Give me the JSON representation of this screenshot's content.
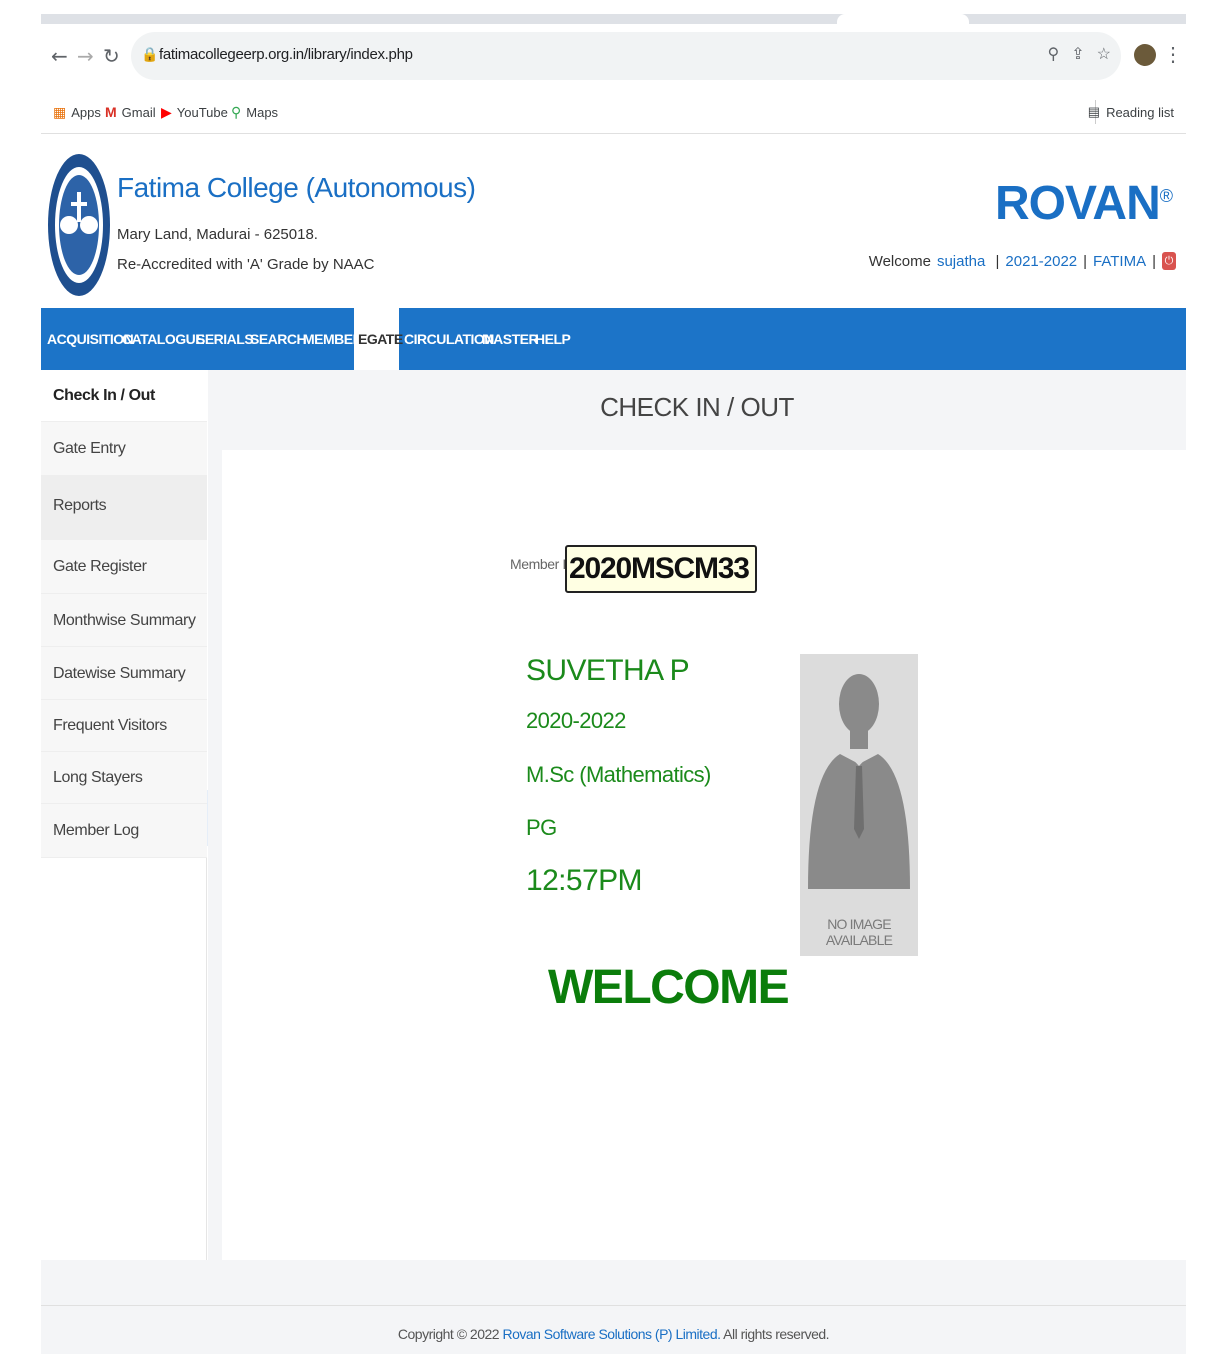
{
  "browser": {
    "url": "fatimacollegeerp.org.in/library/index.php",
    "bookmarks": [
      {
        "label": "Apps",
        "icon": "apps-grid-icon"
      },
      {
        "label": "Gmail",
        "icon": "gmail-icon"
      },
      {
        "label": "YouTube",
        "icon": "youtube-icon"
      },
      {
        "label": "Maps",
        "icon": "maps-pin-icon"
      }
    ],
    "reading_list": "Reading list"
  },
  "header": {
    "college_name": "Fatima College (Autonomous)",
    "address": "Mary Land, Madurai - 625018.",
    "accreditation": "Re-Accredited with 'A' Grade by NAAC",
    "brand": "ROVAN",
    "brand_mark": "®",
    "welcome_text": "Welcome",
    "user": "sujatha",
    "year": "2021-2022",
    "institution": "FATIMA"
  },
  "menu": [
    "ACQUISITION",
    "CATALOGUE",
    "SERIALS",
    "SEARCH",
    "MEMBER",
    "EGATE",
    "CIRCULATION",
    "MASTER",
    "HELP"
  ],
  "active_menu": "EGATE",
  "sidebar": {
    "items": [
      {
        "label": "Check In / Out"
      },
      {
        "label": "Gate Entry"
      },
      {
        "label": "Reports"
      },
      {
        "label": "Gate Register"
      },
      {
        "label": "Monthwise Summary"
      },
      {
        "label": "Datewise Summary"
      },
      {
        "label": "Frequent Visitors"
      },
      {
        "label": "Long Stayers"
      },
      {
        "label": "Member Log"
      }
    ]
  },
  "main": {
    "title": "CHECK IN / OUT",
    "member_id_label": "Member ID",
    "member_id_value": "2020MSCM33",
    "member": {
      "name": "SUVETHA P",
      "batch": "2020-2022",
      "course": "M.Sc (Mathematics)",
      "level": "PG",
      "time": "12:57PM"
    },
    "photo_placeholder": "NO IMAGE AVAILABLE",
    "welcome": "WELCOME"
  },
  "footer": {
    "copyright_prefix": "Copyright © 2022",
    "company": "Rovan Software Solutions (P) Limited.",
    "rights": "All rights reserved."
  },
  "colors": {
    "primary_blue": "#1c74c8",
    "success_green": "#1b8a1b",
    "input_bg": "#ffffe3"
  }
}
